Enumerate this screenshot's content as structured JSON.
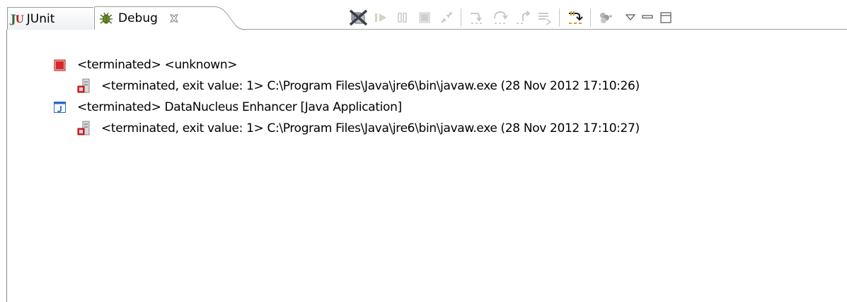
{
  "tabs": [
    {
      "label": "JUnit",
      "icon": "junit-icon",
      "active": false
    },
    {
      "label": "Debug",
      "icon": "bug-icon",
      "active": true
    }
  ],
  "toolbar": {
    "buttons": [
      {
        "icon": "remove-all-terminated-icon",
        "enabled": true
      },
      {
        "icon": "resume-icon",
        "enabled": false
      },
      {
        "icon": "suspend-icon",
        "enabled": false
      },
      {
        "icon": "terminate-icon",
        "enabled": false
      },
      {
        "icon": "disconnect-icon",
        "enabled": false
      },
      {
        "icon": "step-into-icon",
        "enabled": false
      },
      {
        "icon": "step-over-icon",
        "enabled": false
      },
      {
        "icon": "step-return-icon",
        "enabled": false
      },
      {
        "icon": "drop-to-frame-icon",
        "enabled": false
      },
      {
        "icon": "use-step-filters-icon",
        "enabled": true
      },
      {
        "icon": "threads-icon",
        "enabled": true
      },
      {
        "icon": "view-menu-icon",
        "enabled": true
      },
      {
        "icon": "minimize-icon",
        "enabled": true
      },
      {
        "icon": "maximize-icon",
        "enabled": true
      }
    ]
  },
  "tree": [
    {
      "level": 0,
      "icon": "terminated-launch-icon",
      "text": "<terminated> <unknown>"
    },
    {
      "level": 1,
      "icon": "terminated-process-icon",
      "text": "<terminated, exit value: 1> C:\\Program Files\\Java\\jre6\\bin\\javaw.exe (28 Nov 2012 17:10:26)"
    },
    {
      "level": 0,
      "icon": "java-application-icon",
      "text": "<terminated> DataNucleus Enhancer [Java Application]"
    },
    {
      "level": 1,
      "icon": "terminated-process-icon",
      "text": "<terminated, exit value: 1> C:\\Program Files\\Java\\jre6\\bin\\javaw.exe (28 Nov 2012 17:10:27)"
    }
  ],
  "colors": {
    "terminate_red": "#d9262b",
    "java_blue": "#2a6bc0",
    "junit_green": "#2f6b2f",
    "step_filter_gold": "#c9a227"
  }
}
